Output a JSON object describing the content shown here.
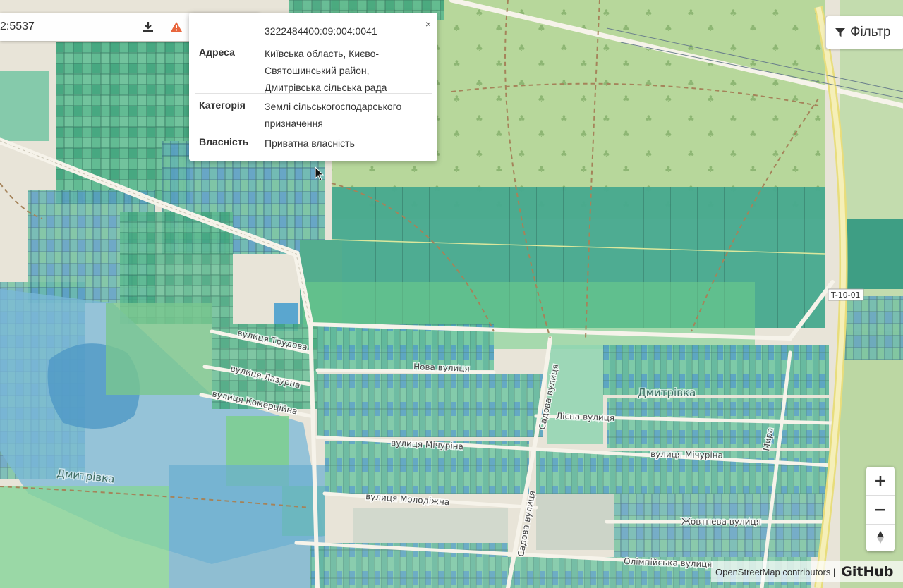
{
  "toolbar": {
    "coordinates": "2:5537",
    "download_icon": "download-icon",
    "warning_icon": "warning-icon",
    "refresh_icon": "refresh-icon",
    "info_icon": "info-icon",
    "warning_color": "#e8663d"
  },
  "popup": {
    "cadastral_number": "3222484400:09:004:0041",
    "close_label": "×",
    "rows": [
      {
        "key": "Адреса",
        "value": "Київська область, Києво-Святошинський район, Дмитрівська сільська рада"
      },
      {
        "key": "Категорія",
        "value": "Землі сільськогосподарського призначення"
      },
      {
        "key": "Власність",
        "value": "Приватна власність"
      }
    ]
  },
  "filter": {
    "label": "Фільтр",
    "icon": "funnel-icon"
  },
  "zoom": {
    "zoom_in": "+",
    "zoom_out": "−",
    "north_icon": "compass-arrow-icon"
  },
  "attribution": {
    "text": "OpenStreetMap contributors |",
    "github": "GitHub"
  },
  "map": {
    "road_ref": "T-10-01",
    "places": [
      "Дмитрівка",
      "Дмитрівка"
    ],
    "streets": [
      "вулиця Трудова",
      "вулиця Лазурна",
      "вулиця Комерційна",
      "Нова вулиця",
      "Садова вулиця",
      "Лісна вулиця",
      "вулиця Мічуріна",
      "вулиця Мічуріна",
      "вулиця Молодіжна",
      "Садова вулиця",
      "Жовтнева вулиця",
      "Олімпійська вулиця",
      "Мира"
    ],
    "colors": {
      "forest": "#b4d89a",
      "parcel_green": "#4fb48c",
      "parcel_blue": "#5a9fc4",
      "water": "#7ab8d8",
      "road": "#f3f0e6",
      "highway": "#f2e6a0"
    }
  }
}
